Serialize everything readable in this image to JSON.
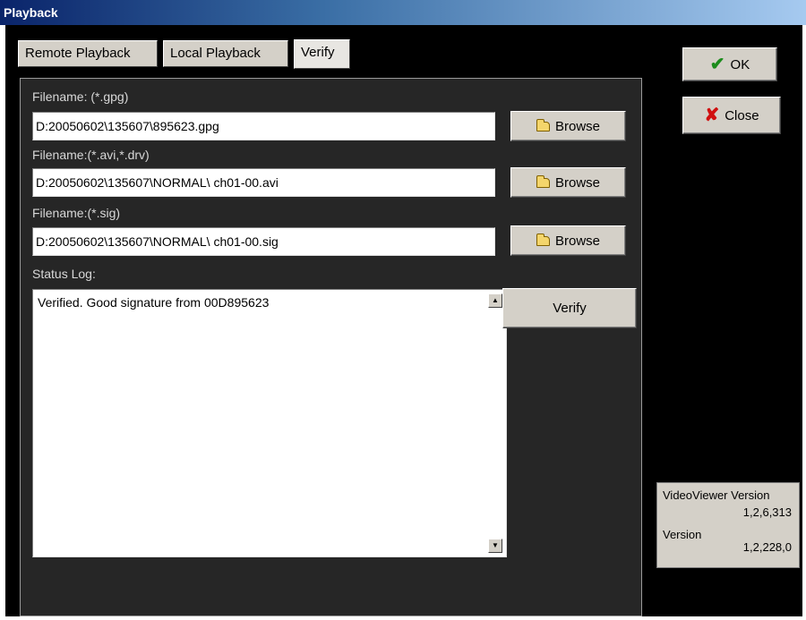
{
  "window": {
    "title": "Playback"
  },
  "tabs": [
    {
      "label": "Remote Playback"
    },
    {
      "label": "Local Playback"
    },
    {
      "label": "Verify"
    }
  ],
  "fields": [
    {
      "label": "Filename: (*.gpg)",
      "value": "D:20050602\\135607\\895623.gpg"
    },
    {
      "label": "Filename:(*.avi,*.drv)",
      "value": "D:20050602\\135607\\NORMAL\\ ch01-00.avi"
    },
    {
      "label": "Filename:(*.sig)",
      "value": "D:20050602\\135607\\NORMAL\\ ch01-00.sig"
    }
  ],
  "browse_label": "Browse",
  "status_log": {
    "label": "Status Log:",
    "text": "Verified. Good signature from 00D895623"
  },
  "verify_button": {
    "label": "Verify"
  },
  "ok_button": {
    "label": "OK"
  },
  "close_button": {
    "label": "Close"
  },
  "version": {
    "title": "VideoViewer Version",
    "viewer_version": "1,2,6,313",
    "label": "Version",
    "version": "1,2,228,0"
  },
  "icons": {
    "ok": "check-icon",
    "close": "x-icon",
    "browse": "folder-icon"
  },
  "colors": {
    "titlebar": "#0a246a",
    "background": "#000000",
    "panel": "#262626",
    "button_face": "#d4d0c8"
  }
}
